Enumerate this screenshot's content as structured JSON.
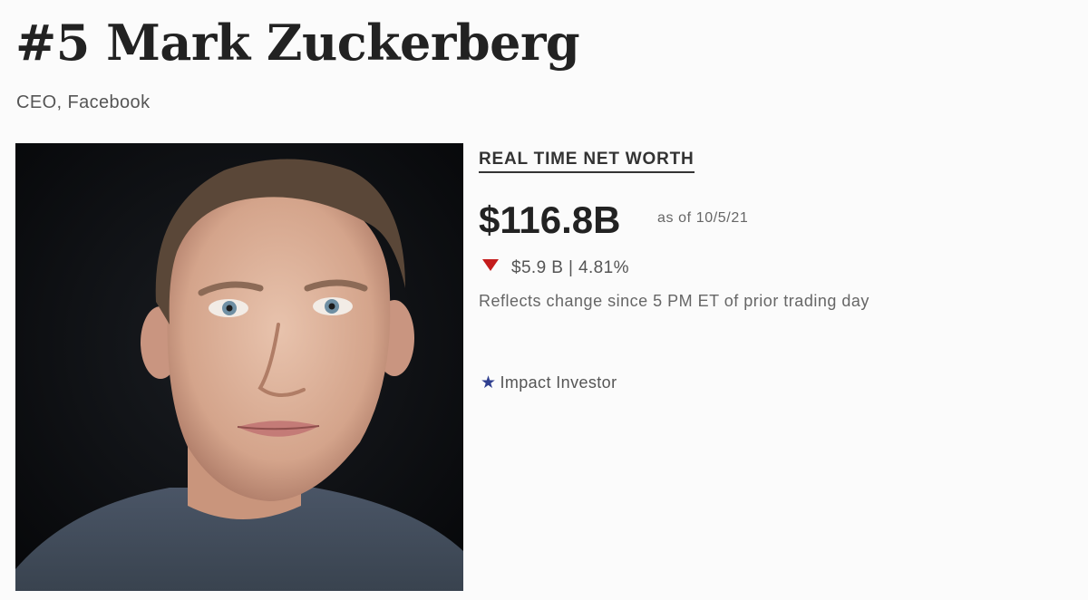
{
  "profile": {
    "title": "#5 Mark Zuckerberg",
    "subtitle": "CEO, Facebook",
    "portrait_icon": "portrait-photo"
  },
  "net_worth": {
    "label": "REAL TIME NET WORTH",
    "value": "$116.8B",
    "as_of": "as of 10/5/21",
    "change_direction_icon": "down-triangle-icon",
    "change_text": "$5.9 B | 4.81%",
    "change_note": "Reflects change since 5 PM ET of prior trading day",
    "down_color": "#c41c1c"
  },
  "badges": [
    {
      "icon": "star-icon",
      "label": "Impact Investor",
      "icon_color": "#2f3f8f"
    }
  ]
}
